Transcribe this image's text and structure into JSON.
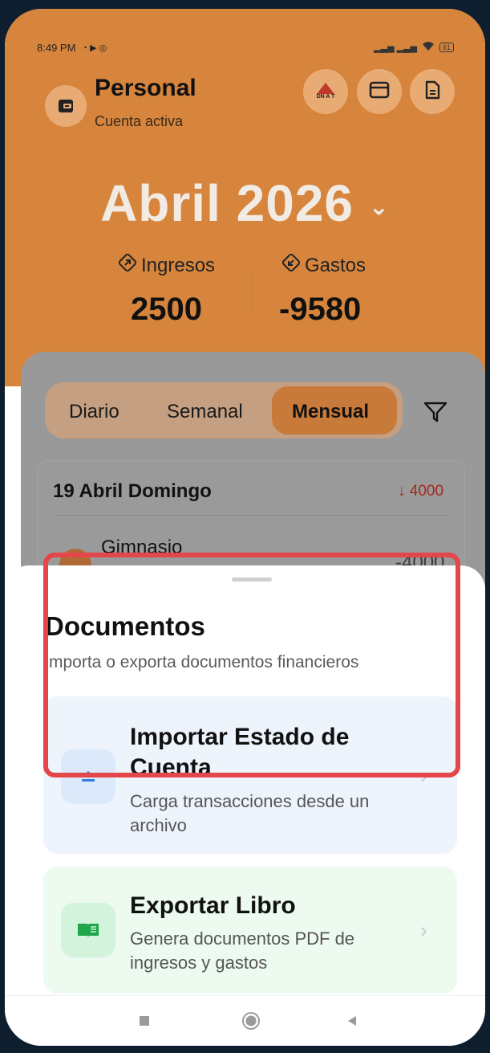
{
  "status_bar": {
    "time": "8:49 PM",
    "battery": "61"
  },
  "header": {
    "account_name": "Personal",
    "account_status": "Cuenta activa",
    "month": "Abril 2026",
    "income_label": "Ingresos",
    "income_value": "2500",
    "expense_label": "Gastos",
    "expense_value": "-9580",
    "badge_text": "DN A T"
  },
  "segments": {
    "daily": "Diario",
    "weekly": "Semanal",
    "monthly": "Mensual"
  },
  "day_card": {
    "title": "19 Abril Domingo",
    "total": "4000",
    "transaction_name": "Gimnasio",
    "transaction_amount": "-4000"
  },
  "sheet": {
    "title": "Documentos",
    "subtitle": "mporta o exporta documentos financieros",
    "options": [
      {
        "title": "Importar Estado de Cuenta",
        "description": "Carga transacciones desde un archivo"
      },
      {
        "title": "Exportar Libro",
        "description": "Genera documentos PDF de ingresos y gastos"
      }
    ]
  },
  "colors": {
    "header_bg": "#d7853d",
    "accent": "#c87a3b",
    "highlight": "#e4474a",
    "import_bg": "#eef4fc",
    "export_bg": "#ecfaf0",
    "negative": "#a3291e"
  },
  "icons": [
    "wallet-icon",
    "bank-icon",
    "card-icon",
    "document-icon",
    "chevron-down-icon",
    "income-icon",
    "expense-icon",
    "filter-icon",
    "upload-icon",
    "book-icon",
    "chevron-right-icon",
    "nav-recents-icon",
    "nav-home-icon",
    "nav-back-icon"
  ]
}
